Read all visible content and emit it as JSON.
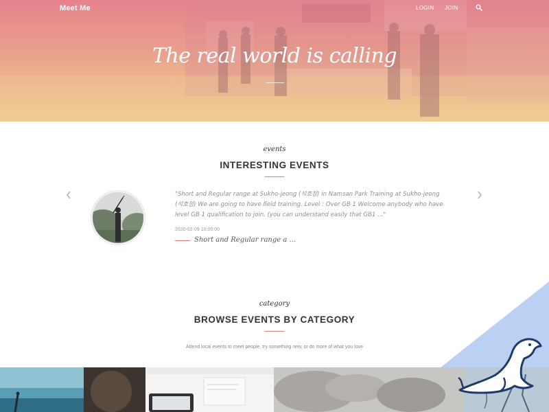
{
  "header": {
    "brand": "Meet Me",
    "nav": {
      "login": "LOGIN",
      "join": "JOIN"
    },
    "search_icon": "search-icon",
    "hero_title": "The real world is calling"
  },
  "events_section": {
    "eyebrow": "events",
    "title": "INTERESTING EVENTS",
    "event": {
      "description": "\"Short and Regular range at Sukho-jeong (석호정) in Namsan Park Training at Sukho-jeong (석호정) We are going to have field training. Level : Over GB 1 Welcome anybody who have level GB 1 qualification to join. (you can understand easily that GB1 ...\"",
      "date": "2020-02-09 10:00:00",
      "name": "Short and Regular range a ..."
    },
    "prev_icon": "chevron-left-icon",
    "next_icon": "chevron-right-icon"
  },
  "category_section": {
    "eyebrow": "category",
    "title": "BROWSE EVENTS BY CATEGORY",
    "subtitle": "Attend local events to meet people, try something new, or do more of what you love"
  },
  "colors": {
    "accent": "#e07b7b",
    "hero_top": "#e48a8e",
    "hero_bottom": "#eccb90",
    "corner_blue": "#bcd0f3",
    "seal_navy": "#1f3a68"
  }
}
